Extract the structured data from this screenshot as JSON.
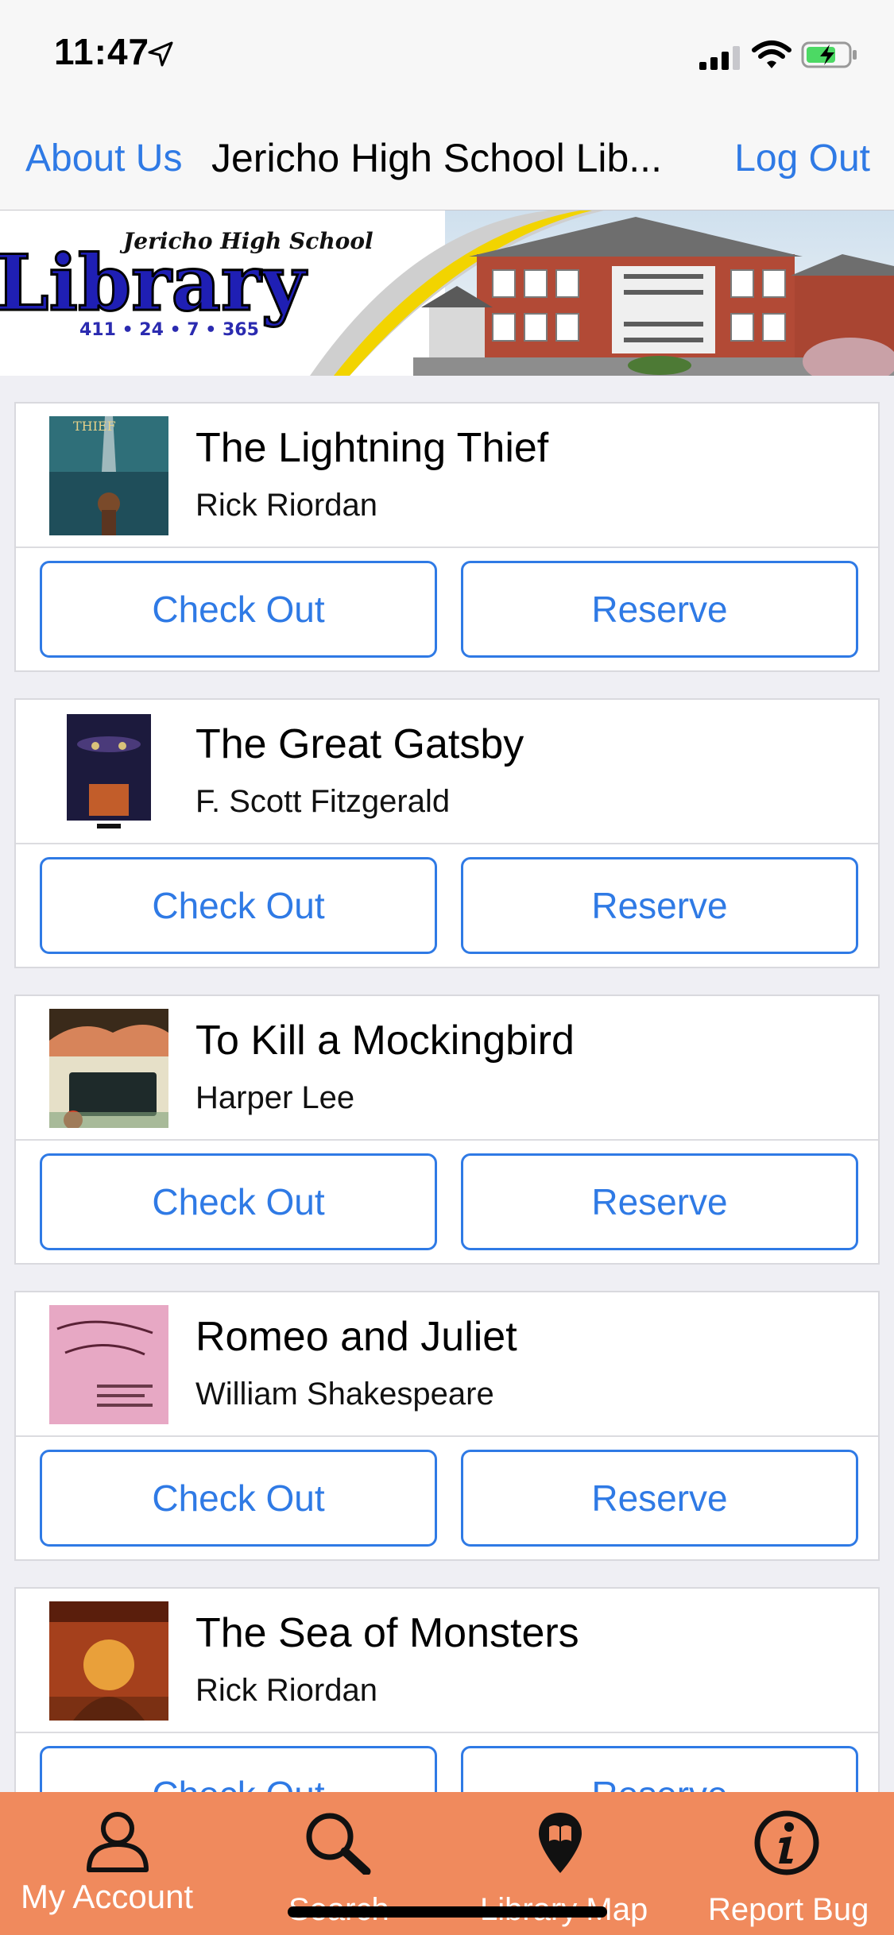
{
  "status_bar": {
    "time": "11:47"
  },
  "nav": {
    "left": "About Us",
    "title": "Jericho High School Lib...",
    "right": "Log Out"
  },
  "banner": {
    "line1": "Jericho High School",
    "line2": "Library",
    "line3": "411 • 24 • 7 • 365"
  },
  "books": [
    {
      "title": "The Lightning Thief",
      "author": "Rick Riordan",
      "checkout": "Check Out",
      "reserve": "Reserve"
    },
    {
      "title": "The Great Gatsby",
      "author": "F. Scott Fitzgerald",
      "checkout": "Check Out",
      "reserve": "Reserve"
    },
    {
      "title": "To Kill a Mockingbird",
      "author": "Harper Lee",
      "checkout": "Check Out",
      "reserve": "Reserve"
    },
    {
      "title": "Romeo and Juliet",
      "author": "William Shakespeare",
      "checkout": "Check Out",
      "reserve": "Reserve"
    },
    {
      "title": "The Sea of Monsters",
      "author": "Rick Riordan",
      "checkout": "Check Out",
      "reserve": "Reserve"
    }
  ],
  "tabs": [
    {
      "label": "My Account",
      "icon": "person-icon"
    },
    {
      "label": "Search",
      "icon": "search-icon"
    },
    {
      "label": "Library Map",
      "icon": "map-pin-book-icon"
    },
    {
      "label": "Report Bug",
      "icon": "info-icon"
    }
  ],
  "colors": {
    "accent": "#2f7ae5",
    "tab_bar": "#f08a5d",
    "background": "#efeff4"
  }
}
